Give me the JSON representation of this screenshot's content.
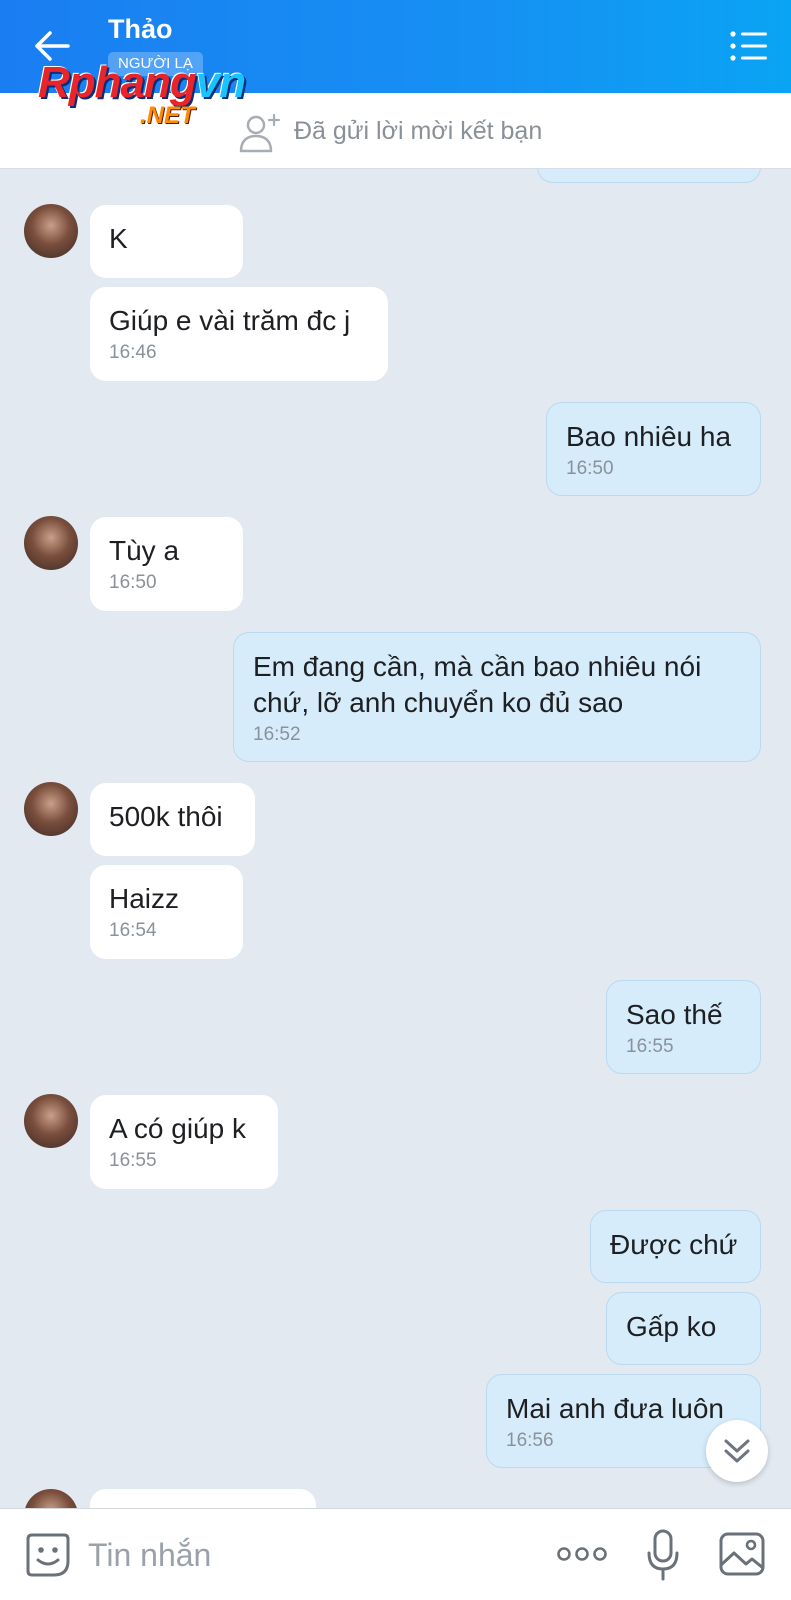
{
  "header": {
    "contact_name": "Thảo",
    "badge": "NGƯỜI LẠ",
    "back_icon": "arrow-left-icon",
    "menu_icon": "list-menu-icon",
    "colors": {
      "start": "#1a7ef2",
      "end": "#0aa4f4"
    }
  },
  "watermark": {
    "main_red": "Rphang",
    "main_blue": "vn",
    "sub": ".NET"
  },
  "friend_bar": {
    "icon": "add-friend-icon",
    "text": "Đã gửi lời mời kết bạn"
  },
  "conversation": {
    "messages": [
      {
        "from": "contact",
        "text": "K",
        "time": ""
      },
      {
        "from": "contact",
        "text": "Giúp e vài trăm đc j",
        "time": "16:46"
      },
      {
        "from": "me",
        "text": "Bao nhiêu ha",
        "time": "16:50"
      },
      {
        "from": "contact",
        "text": "Tùy a",
        "time": "16:50"
      },
      {
        "from": "me",
        "text": "Em đang cần, mà cần bao nhiêu nói chứ, lỡ anh chuyển ko đủ sao",
        "time": "16:52"
      },
      {
        "from": "contact",
        "text": "500k thôi",
        "time": ""
      },
      {
        "from": "contact",
        "text": "Haizz",
        "time": "16:54"
      },
      {
        "from": "me",
        "text": "Sao thế",
        "time": "16:55"
      },
      {
        "from": "contact",
        "text": "A có giúp k",
        "time": "16:55"
      },
      {
        "from": "me",
        "text": "Được chứ",
        "time": ""
      },
      {
        "from": "me",
        "text": "Gấp ko",
        "time": ""
      },
      {
        "from": "me",
        "text": "Mai anh đưa luôn",
        "time": "16:56"
      }
    ]
  },
  "input_bar": {
    "placeholder": "Tin nhắn",
    "icons": [
      "sticker-icon",
      "more-icon",
      "microphone-icon",
      "image-icon"
    ]
  },
  "scroll_button": {
    "icon": "double-chevron-down-icon"
  }
}
